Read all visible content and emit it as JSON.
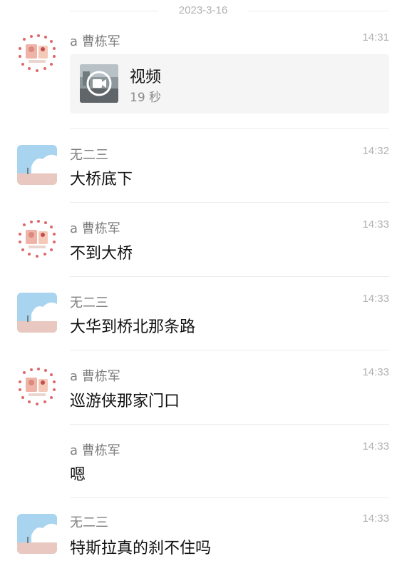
{
  "date_divider": "2023-3-16",
  "messages": [
    {
      "sender": "a 曹栋军",
      "time": "14:31",
      "avatar": "heart-photo-avatar",
      "video": {
        "title": "视频",
        "duration": "19 秒",
        "icon": "video-camera-icon"
      }
    },
    {
      "sender": "无二三",
      "time": "14:32",
      "avatar": "sky-avatar",
      "text": "大桥底下"
    },
    {
      "sender": "a 曹栋军",
      "time": "14:33",
      "avatar": "heart-photo-avatar",
      "text": "不到大桥"
    },
    {
      "sender": "无二三",
      "time": "14:33",
      "avatar": "sky-avatar",
      "text": "大华到桥北那条路"
    },
    {
      "sender": "a 曹栋军",
      "time": "14:33",
      "avatar": "heart-photo-avatar",
      "text": "巡游侠那家门口"
    },
    {
      "sender": "a 曹栋军",
      "time": "14:33",
      "text": "嗯"
    },
    {
      "sender": "无二三",
      "time": "14:33",
      "avatar": "sky-avatar",
      "text": "特斯拉真的刹不住吗"
    }
  ]
}
